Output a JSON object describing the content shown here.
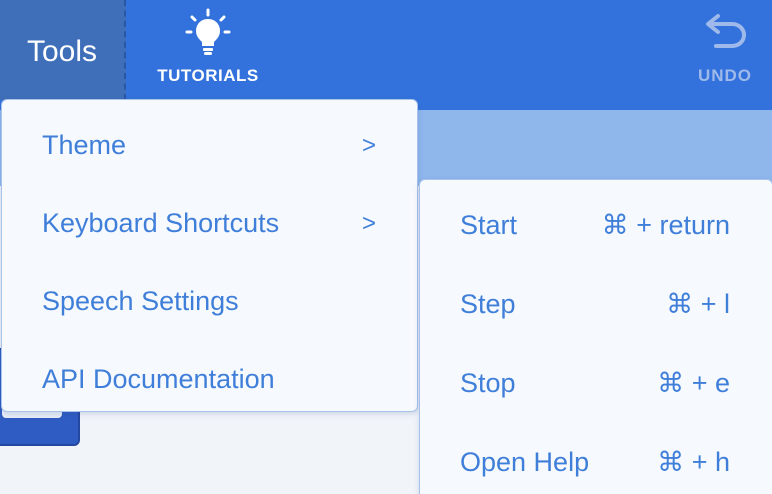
{
  "toolbar": {
    "tools_label": "Tools",
    "tutorials_label": "TUTORIALS",
    "undo_label": "UNDO"
  },
  "tools_menu": {
    "items": [
      {
        "label": "Theme",
        "arrow": ">"
      },
      {
        "label": "Keyboard Shortcuts",
        "arrow": ">"
      },
      {
        "label": "Speech Settings",
        "arrow": ""
      },
      {
        "label": "API Documentation",
        "arrow": ""
      }
    ]
  },
  "shortcuts_menu": {
    "items": [
      {
        "label": "Start",
        "keys": "⌘ + return"
      },
      {
        "label": "Step",
        "keys": "⌘ + l"
      },
      {
        "label": "Stop",
        "keys": "⌘ + e"
      },
      {
        "label": "Open Help",
        "keys": "⌘ + h"
      }
    ]
  },
  "colors": {
    "toolbar_bg": "#3372dc",
    "tools_button_bg": "#3f6fb9",
    "menu_text": "#3f7fd9",
    "menu_bg": "#f6f9fd",
    "undo_disabled": "#9fbaea"
  },
  "icons": {
    "tutorials": "lightbulb-icon",
    "undo": "undo-arrow-icon"
  }
}
